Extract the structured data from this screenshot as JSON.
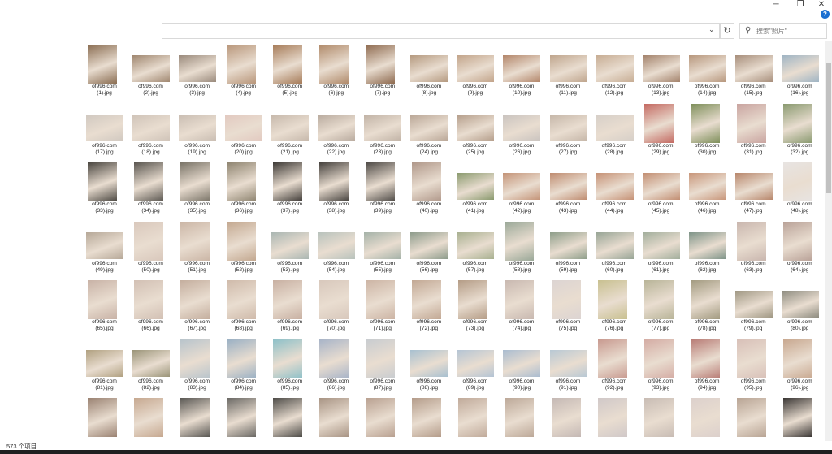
{
  "window": {
    "min_label": "─",
    "max_label": "❐",
    "close_label": "✕",
    "help_label": "?"
  },
  "address": {
    "chevron": "⌄",
    "refresh": "↻"
  },
  "search": {
    "placeholder": "搜索\"照片\""
  },
  "status": {
    "item_count": "573 个项目"
  },
  "files": {
    "prefix": "of996.com",
    "names": [
      "(1).jpg",
      "(2).jpg",
      "(3).jpg",
      "(4).jpg",
      "(5).jpg",
      "(6).jpg",
      "(7).jpg",
      "(8).jpg",
      "(9).jpg",
      "(10).jpg",
      "(11).jpg",
      "(12).jpg",
      "(13).jpg",
      "(14).jpg",
      "(15).jpg",
      "(16).jpg",
      "(17).jpg",
      "(18).jpg",
      "(19).jpg",
      "(20).jpg",
      "(21).jpg",
      "(22).jpg",
      "(23).jpg",
      "(24).jpg",
      "(25).jpg",
      "(26).jpg",
      "(27).jpg",
      "(28).jpg",
      "(29).jpg",
      "(30).jpg",
      "(31).jpg",
      "(32).jpg",
      "(33).jpg",
      "(34).jpg",
      "(35).jpg",
      "(36).jpg",
      "(37).jpg",
      "(38).jpg",
      "(39).jpg",
      "(40).jpg",
      "(41).jpg",
      "(42).jpg",
      "(43).jpg",
      "(44).jpg",
      "(45).jpg",
      "(46).jpg",
      "(47).jpg",
      "(48).jpg",
      "(49).jpg",
      "(50).jpg",
      "(51).jpg",
      "(52).jpg",
      "(53).jpg",
      "(54).jpg",
      "(55).jpg",
      "(56).jpg",
      "(57).jpg",
      "(58).jpg",
      "(59).jpg",
      "(60).jpg",
      "(61).jpg",
      "(62).jpg",
      "(63).jpg",
      "(64).jpg",
      "(65).jpg",
      "(66).jpg",
      "(67).jpg",
      "(68).jpg",
      "(69).jpg",
      "(70).jpg",
      "(71).jpg",
      "(72).jpg",
      "(73).jpg",
      "(74).jpg",
      "(75).jpg",
      "(76).jpg",
      "(77).jpg",
      "(78).jpg",
      "(79).jpg",
      "(80).jpg",
      "(81).jpg",
      "(82).jpg",
      "(83).jpg",
      "(84).jpg",
      "(85).jpg",
      "(86).jpg",
      "(87).jpg",
      "(88).jpg",
      "(89).jpg",
      "(90).jpg",
      "(91).jpg",
      "(92).jpg",
      "(93).jpg",
      "(94).jpg",
      "(95).jpg",
      "(96).jpg"
    ],
    "orientation": [
      "t",
      "w",
      "w",
      "t",
      "t",
      "t",
      "t",
      "w",
      "w",
      "w",
      "w",
      "w",
      "w",
      "w",
      "w",
      "w",
      "w",
      "w",
      "w",
      "w",
      "w",
      "w",
      "w",
      "w",
      "w",
      "w",
      "w",
      "w",
      "t",
      "t",
      "t",
      "t",
      "t",
      "t",
      "t",
      "t",
      "t",
      "t",
      "t",
      "t",
      "w",
      "w",
      "w",
      "w",
      "w",
      "w",
      "w",
      "t",
      "w",
      "t",
      "t",
      "t",
      "w",
      "w",
      "w",
      "w",
      "w",
      "t",
      "w",
      "w",
      "w",
      "w",
      "t",
      "t",
      "t",
      "t",
      "t",
      "t",
      "t",
      "t",
      "t",
      "t",
      "t",
      "t",
      "t",
      "t",
      "t",
      "t",
      "w",
      "w",
      "w",
      "w",
      "t",
      "t",
      "t",
      "t",
      "t",
      "w",
      "w",
      "w",
      "w",
      "t",
      "t",
      "t",
      "t",
      "t"
    ],
    "tones": [
      "#8a6d52",
      "#a08770",
      "#9a8a7c",
      "#b8967a",
      "#a67b58",
      "#b08a6a",
      "#8e6a4f",
      "#b59a80",
      "#c2a48a",
      "#b3866a",
      "#bfa58d",
      "#c7ad94",
      "#a3826b",
      "#b7977d",
      "#a88f7c",
      "#9fb4c4",
      "#d0c8c0",
      "#cfc3b8",
      "#c9bdb2",
      "#e2c9c0",
      "#c6b8ab",
      "#b8aa9e",
      "#c0b2a5",
      "#b9a696",
      "#b49d8a",
      "#c9c3bf",
      "#c5b6a8",
      "#d6cfc8",
      "#c46a62",
      "#7e8f5a",
      "#c9a4a0",
      "#8a9a70",
      "#4a4640",
      "#5a5650",
      "#7a7468",
      "#8e8470",
      "#3e3a36",
      "#46423e",
      "#4e4a46",
      "#b0988a",
      "#8a9a6e",
      "#c49478",
      "#bf8c70",
      "#c69276",
      "#c28e72",
      "#c8967a",
      "#b8876c",
      "#e8e4e2",
      "#b6a898",
      "#d9c8bc",
      "#cbb6a6",
      "#c3a890",
      "#aab6b2",
      "#b8c2bc",
      "#a5b2a8",
      "#8e9c8c",
      "#a8b090",
      "#9aa898",
      "#8e9e8a",
      "#98a596",
      "#a2ae9c",
      "#7e9488",
      "#c9b6ae",
      "#b9a298",
      "#c8b2a6",
      "#d2c0b4",
      "#c4ae9e",
      "#cfbaaa",
      "#c8b0a2",
      "#d8c8bc",
      "#ccb4a4",
      "#c2a894",
      "#b49c86",
      "#c8b8b0",
      "#dcd4d2",
      "#c8c090",
      "#b8b498",
      "#a29a80",
      "#a09884",
      "#8e8c80",
      "#b0a080",
      "#9a9478",
      "#b8c4cc",
      "#9ab0c4",
      "#8ec0c8",
      "#a8b4c8",
      "#c8ccd0",
      "#a8c0d0",
      "#b4c4d4",
      "#aabcd0",
      "#b8c8d4",
      "#c89a90",
      "#d4aca4",
      "#b87c76",
      "#d8c0b8",
      "#c8a890"
    ],
    "rows_partial_tones": [
      "#9a8272",
      "#c6a890",
      "#5a5854",
      "#6a6864",
      "#4e4c48",
      "#a89484",
      "#b8a090",
      "#b49c8a",
      "#c0aa9a",
      "#bca898",
      "#c4b8b4",
      "#d0c8c8",
      "#c8bcb4",
      "#dcd0cc",
      "#b8a494",
      "#3a3634"
    ]
  }
}
